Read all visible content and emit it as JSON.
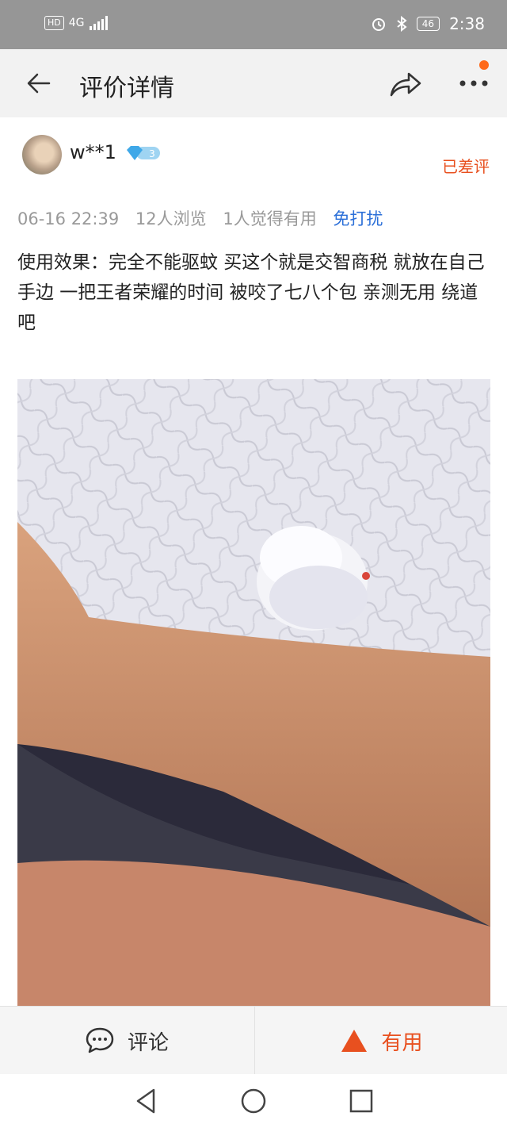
{
  "status_bar": {
    "hd": "HD",
    "signal": "4G",
    "battery": "46",
    "time": "2:38"
  },
  "header": {
    "title": "评价详情"
  },
  "review": {
    "username": "w**1",
    "level": "3",
    "status": "已差评",
    "date": "06-16 22:39",
    "views": "12人浏览",
    "helpful_count": "1人觉得有用",
    "dnd": "免打扰",
    "content": "使用效果：完全不能驱蚊 买这个就是交智商税 就放在自己手边 一把王者荣耀的时间 被咬了七八个包 亲测无用 绕道吧"
  },
  "bottom_bar": {
    "comment_label": "评论",
    "useful_label": "有用"
  },
  "colors": {
    "accent": "#e8501f",
    "link": "#2b6fd8",
    "statusbar": "#969696",
    "appbar": "#f2f2f2"
  }
}
